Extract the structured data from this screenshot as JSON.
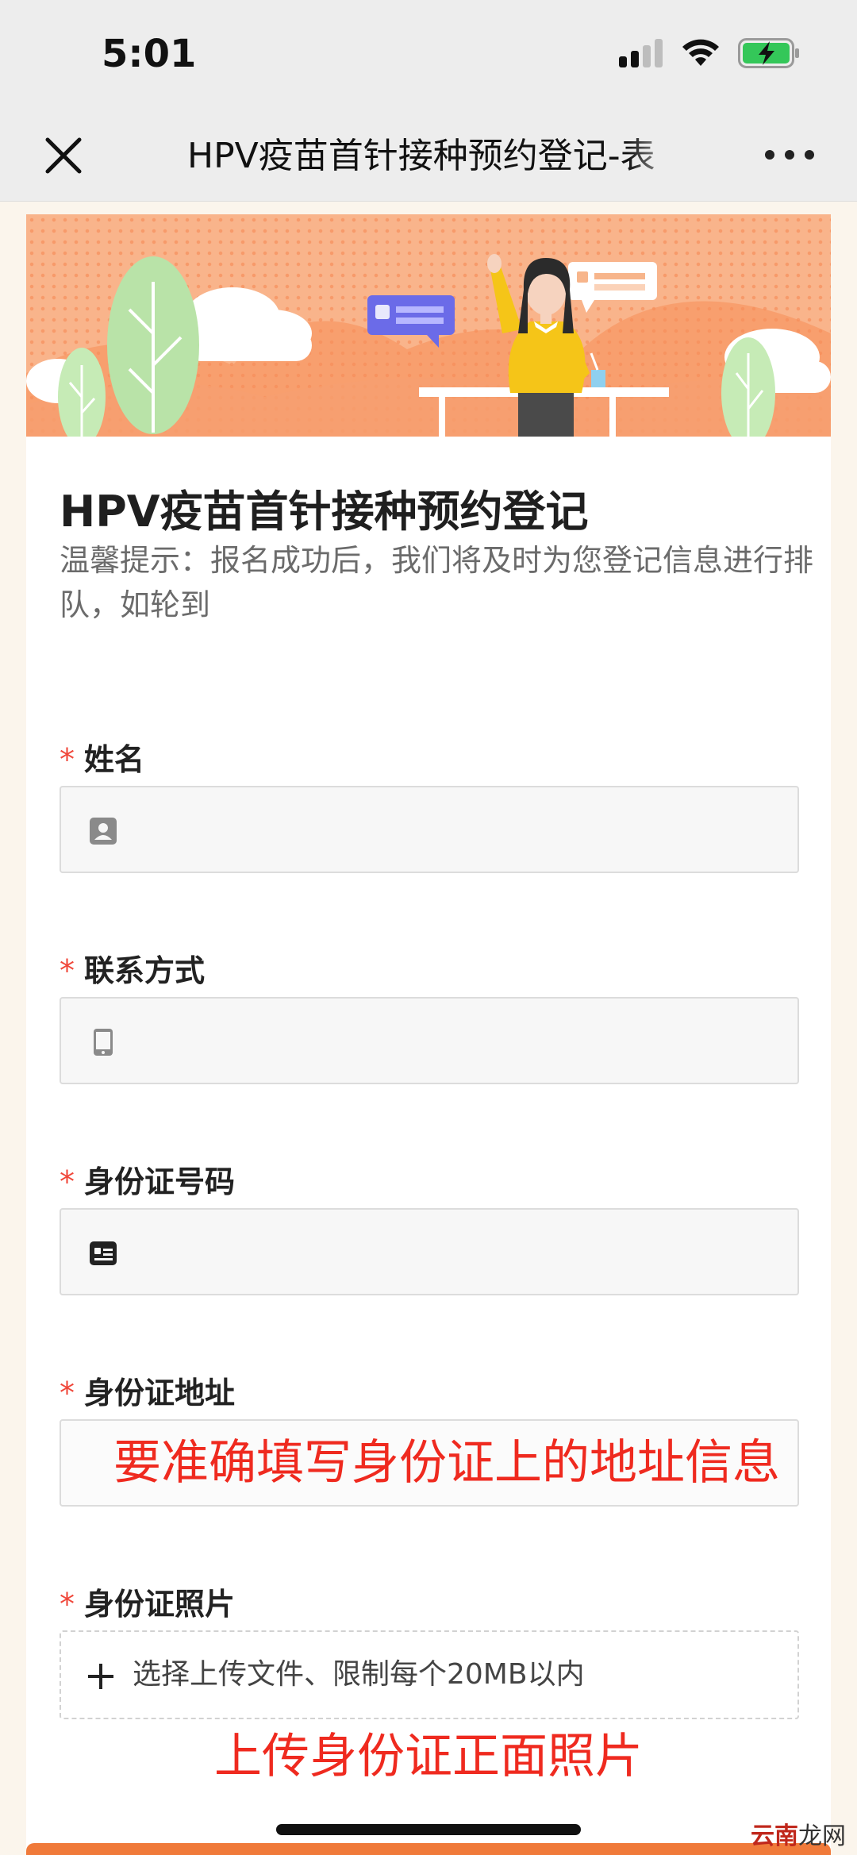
{
  "status_bar": {
    "time": "5:01",
    "battery_color": "#34c759"
  },
  "nav": {
    "title": "HPV疫苗首针接种预约登记-表",
    "close_icon": "close-icon",
    "more_icon": "more-dots-icon"
  },
  "form": {
    "title": "HPV疫苗首针接种预约登记",
    "hint": "温馨提示：报名成功后，我们将及时为您登记信息进行排队，如轮到",
    "required_mark": "*",
    "fields": [
      {
        "label": "姓名",
        "icon": "person-card-icon",
        "value": ""
      },
      {
        "label": "联系方式",
        "icon": "phone-icon",
        "value": ""
      },
      {
        "label": "身份证号码",
        "icon": "id-card-icon",
        "value": ""
      },
      {
        "label": "身份证地址",
        "value": "",
        "overlay_note": "要准确填写身份证上的地址信息"
      },
      {
        "label": "身份证照片",
        "upload_text": "选择上传文件、限制每个20MB以内",
        "overlay_note": "上传身份证正面照片"
      }
    ]
  },
  "colors": {
    "accent": "#f07a3a",
    "required": "#f0473a",
    "annotation_red": "#ef2a1f",
    "banner": "#f9b48b"
  },
  "watermark": {
    "part1": "云南",
    "part2": "龙网"
  }
}
